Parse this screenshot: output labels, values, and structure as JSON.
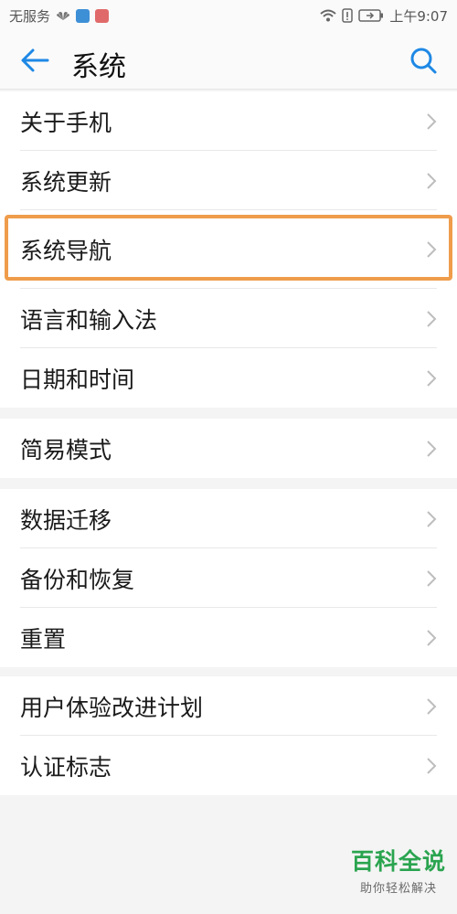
{
  "status": {
    "carrier": "无服务",
    "time": "上午9:07",
    "icons": [
      "huawei-logo-icon",
      "app-badge-blue-icon",
      "app-badge-red-icon",
      "wifi-icon",
      "alert-icon",
      "battery-icon"
    ]
  },
  "header": {
    "title": "系统",
    "back_icon": "arrow-left-icon",
    "search_icon": "search-icon",
    "accent_color": "#1e88e5"
  },
  "groups": [
    {
      "items": [
        {
          "label": "关于手机"
        },
        {
          "label": "系统更新"
        },
        {
          "label": "系统导航"
        },
        {
          "label": "语言和输入法"
        },
        {
          "label": "日期和时间"
        }
      ]
    },
    {
      "items": [
        {
          "label": "简易模式"
        }
      ]
    },
    {
      "items": [
        {
          "label": "数据迁移"
        },
        {
          "label": "备份和恢复"
        },
        {
          "label": "重置"
        }
      ]
    },
    {
      "items": [
        {
          "label": "用户体验改进计划"
        },
        {
          "label": "认证标志"
        }
      ]
    }
  ],
  "highlight_color": "#ef9c4b",
  "watermark": {
    "title": "百科全说",
    "subtitle": "助你轻松解决"
  }
}
